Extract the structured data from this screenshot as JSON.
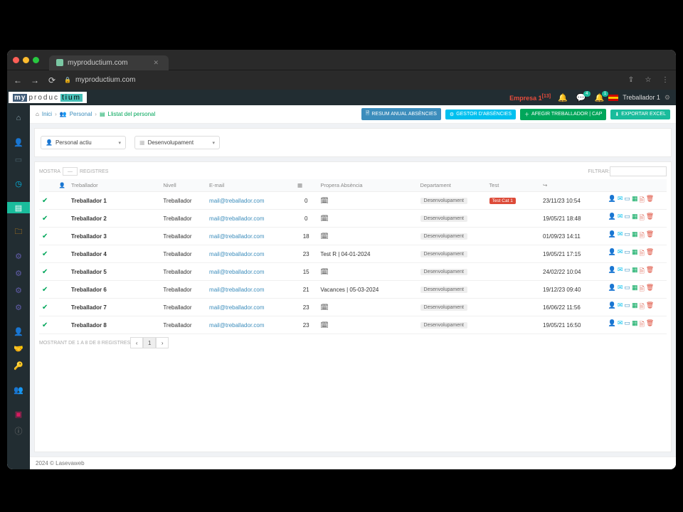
{
  "browser": {
    "tab_title": "myproductium.com",
    "url": "myproductium.com"
  },
  "appbar": {
    "company": "Empresa 1",
    "company_badge": "[13]",
    "chat_badge": "4",
    "bell2_badge": "1",
    "user": "Treballador 1"
  },
  "breadcrumb": {
    "home": "Inici",
    "section": "Personal",
    "page": "Llistat del personal"
  },
  "action_buttons": {
    "resum": "RESUM ANUAL ABSÈNCIES",
    "gestor": "GESTOR D'ABSÈNCIES",
    "afegir": "AFEGIR TREBALLADOR | CAP",
    "export": "EXPORTAR EXCEL"
  },
  "filters": {
    "status": "Personal actiu",
    "department": "Desenvolupament"
  },
  "table_toolbar": {
    "show": "MOSTRA",
    "records": "REGISTRES",
    "filter_label": "FILTRAR:"
  },
  "columns": {
    "name": "Treballador",
    "level": "Nivell",
    "email": "E-mail",
    "absence": "Propera Absència",
    "dept": "Departament",
    "test": "Test"
  },
  "rows": [
    {
      "name": "Treballador 1",
      "level": "Treballador",
      "email": "mail@treballador.com",
      "count": "0",
      "cal": "1",
      "absence": "",
      "dept": "Desenvolupament",
      "test": "Test Cat 1",
      "date": "23/11/23 10:54"
    },
    {
      "name": "Treballador 2",
      "level": "Treballador",
      "email": "mail@treballador.com",
      "count": "0",
      "cal": "1",
      "absence": "",
      "dept": "Desenvolupament",
      "test": "",
      "date": "19/05/21 18:48"
    },
    {
      "name": "Treballador 3",
      "level": "Treballador",
      "email": "mail@treballador.com",
      "count": "18",
      "cal": "1",
      "absence": "",
      "dept": "Desenvolupament",
      "test": "",
      "date": "01/09/23 14:11"
    },
    {
      "name": "Treballador 4",
      "level": "Treballador",
      "email": "mail@treballador.com",
      "count": "23",
      "cal": "0",
      "absence": "Test R | 04-01-2024",
      "dept": "Desenvolupament",
      "test": "",
      "date": "19/05/21 17:15"
    },
    {
      "name": "Treballador 5",
      "level": "Treballador",
      "email": "mail@treballador.com",
      "count": "15",
      "cal": "1",
      "absence": "",
      "dept": "Desenvolupament",
      "test": "",
      "date": "24/02/22 10:04"
    },
    {
      "name": "Treballador 6",
      "level": "Treballador",
      "email": "mail@treballador.com",
      "count": "21",
      "cal": "0",
      "absence": "Vacances | 05-03-2024",
      "dept": "Desenvolupament",
      "test": "",
      "date": "19/12/23 09:40"
    },
    {
      "name": "Treballador 7",
      "level": "Treballador",
      "email": "mail@treballador.com",
      "count": "23",
      "cal": "1",
      "absence": "",
      "dept": "Desenvolupament",
      "test": "",
      "date": "16/06/22 11:56"
    },
    {
      "name": "Treballador 8",
      "level": "Treballador",
      "email": "mail@treballador.com",
      "count": "23",
      "cal": "1",
      "absence": "",
      "dept": "Desenvolupament",
      "test": "",
      "date": "19/05/21 16:50"
    }
  ],
  "footer_count": "MOSTRANT DE 1 A 8 DE 8 REGISTRES",
  "page_current": "1",
  "copyright": "2024 © Lasevaweb"
}
